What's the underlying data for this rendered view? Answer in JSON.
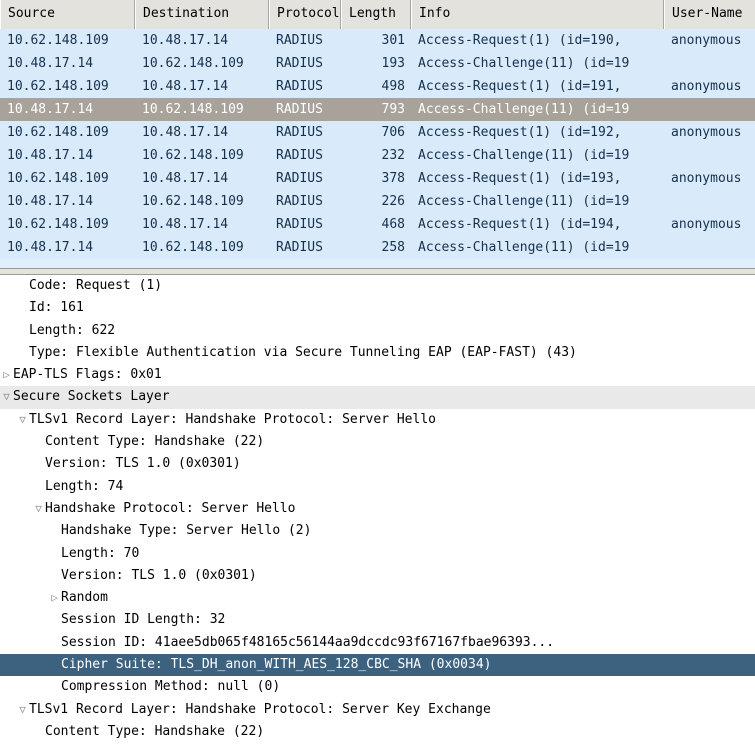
{
  "packet_list": {
    "columns": [
      {
        "label": "Source",
        "key": "source"
      },
      {
        "label": "Destination",
        "key": "destination"
      },
      {
        "label": "Protocol",
        "key": "protocol"
      },
      {
        "label": "Length",
        "key": "length"
      },
      {
        "label": "Info",
        "key": "info"
      },
      {
        "label": "User-Name",
        "key": "user_name"
      }
    ],
    "rows": [
      {
        "source": "10.62.148.109",
        "destination": "10.48.17.14",
        "protocol": "RADIUS",
        "length": "301",
        "info": "Access-Request(1) (id=190, ",
        "user_name": "anonymous",
        "selected": false
      },
      {
        "source": "10.48.17.14",
        "destination": "10.62.148.109",
        "protocol": "RADIUS",
        "length": "193",
        "info": "Access-Challenge(11) (id=19",
        "user_name": "",
        "selected": false
      },
      {
        "source": "10.62.148.109",
        "destination": "10.48.17.14",
        "protocol": "RADIUS",
        "length": "498",
        "info": "Access-Request(1) (id=191, ",
        "user_name": "anonymous",
        "selected": false
      },
      {
        "source": "10.48.17.14",
        "destination": "10.62.148.109",
        "protocol": "RADIUS",
        "length": "793",
        "info": "Access-Challenge(11) (id=19",
        "user_name": "",
        "selected": true
      },
      {
        "source": "10.62.148.109",
        "destination": "10.48.17.14",
        "protocol": "RADIUS",
        "length": "706",
        "info": "Access-Request(1) (id=192, ",
        "user_name": "anonymous",
        "selected": false
      },
      {
        "source": "10.48.17.14",
        "destination": "10.62.148.109",
        "protocol": "RADIUS",
        "length": "232",
        "info": "Access-Challenge(11) (id=19",
        "user_name": "",
        "selected": false
      },
      {
        "source": "10.62.148.109",
        "destination": "10.48.17.14",
        "protocol": "RADIUS",
        "length": "378",
        "info": "Access-Request(1) (id=193, ",
        "user_name": "anonymous",
        "selected": false
      },
      {
        "source": "10.48.17.14",
        "destination": "10.62.148.109",
        "protocol": "RADIUS",
        "length": "226",
        "info": "Access-Challenge(11) (id=19",
        "user_name": "",
        "selected": false
      },
      {
        "source": "10.62.148.109",
        "destination": "10.48.17.14",
        "protocol": "RADIUS",
        "length": "468",
        "info": "Access-Request(1) (id=194, ",
        "user_name": "anonymous",
        "selected": false
      },
      {
        "source": "10.48.17.14",
        "destination": "10.62.148.109",
        "protocol": "RADIUS",
        "length": "258",
        "info": "Access-Challenge(11) (id=19",
        "user_name": "",
        "selected": false
      }
    ]
  },
  "detail_tree": {
    "rows": [
      {
        "text": "Code: Request (1)",
        "indent": 1,
        "twisty": "none",
        "style": "normal"
      },
      {
        "text": "Id: 161",
        "indent": 1,
        "twisty": "none",
        "style": "normal"
      },
      {
        "text": "Length: 622",
        "indent": 1,
        "twisty": "none",
        "style": "normal"
      },
      {
        "text": "Type: Flexible Authentication via Secure Tunneling EAP (EAP-FAST) (43)",
        "indent": 1,
        "twisty": "none",
        "style": "normal"
      },
      {
        "text": "EAP-TLS Flags: 0x01",
        "indent": 0,
        "twisty": "collapsed",
        "style": "normal"
      },
      {
        "text": "Secure Sockets Layer",
        "indent": 0,
        "twisty": "expanded",
        "style": "band"
      },
      {
        "text": "TLSv1 Record Layer: Handshake Protocol: Server Hello",
        "indent": 1,
        "twisty": "expanded",
        "style": "normal"
      },
      {
        "text": "Content Type: Handshake (22)",
        "indent": 2,
        "twisty": "none",
        "style": "normal"
      },
      {
        "text": "Version: TLS 1.0 (0x0301)",
        "indent": 2,
        "twisty": "none",
        "style": "normal"
      },
      {
        "text": "Length: 74",
        "indent": 2,
        "twisty": "none",
        "style": "normal"
      },
      {
        "text": "Handshake Protocol: Server Hello",
        "indent": 2,
        "twisty": "expanded",
        "style": "normal"
      },
      {
        "text": "Handshake Type: Server Hello (2)",
        "indent": 3,
        "twisty": "none",
        "style": "normal"
      },
      {
        "text": "Length: 70",
        "indent": 3,
        "twisty": "none",
        "style": "normal"
      },
      {
        "text": "Version: TLS 1.0 (0x0301)",
        "indent": 3,
        "twisty": "none",
        "style": "normal"
      },
      {
        "text": "Random",
        "indent": 3,
        "twisty": "collapsed",
        "style": "normal"
      },
      {
        "text": "Session ID Length: 32",
        "indent": 3,
        "twisty": "none",
        "style": "normal"
      },
      {
        "text": "Session ID: 41aee5db065f48165c56144aa9dccdc93f67167fbae96393...",
        "indent": 3,
        "twisty": "none",
        "style": "normal"
      },
      {
        "text": "Cipher Suite: TLS_DH_anon_WITH_AES_128_CBC_SHA (0x0034)",
        "indent": 3,
        "twisty": "none",
        "style": "selected"
      },
      {
        "text": "Compression Method: null (0)",
        "indent": 3,
        "twisty": "none",
        "style": "normal"
      },
      {
        "text": "TLSv1 Record Layer: Handshake Protocol: Server Key Exchange",
        "indent": 1,
        "twisty": "expanded",
        "style": "normal"
      },
      {
        "text": "Content Type: Handshake (22)",
        "indent": 2,
        "twisty": "none",
        "style": "normal"
      }
    ],
    "glyphs": {
      "collapsed": "▷",
      "expanded": "▽",
      "none": " "
    }
  },
  "colors": {
    "packet_row_bg": "#d9eafb",
    "packet_row_selected_bg": "#a8a29a",
    "header_bg": "#e4e2dd",
    "tree_selected_bg": "#3d6280",
    "tree_band_bg": "#e9e9e9"
  }
}
